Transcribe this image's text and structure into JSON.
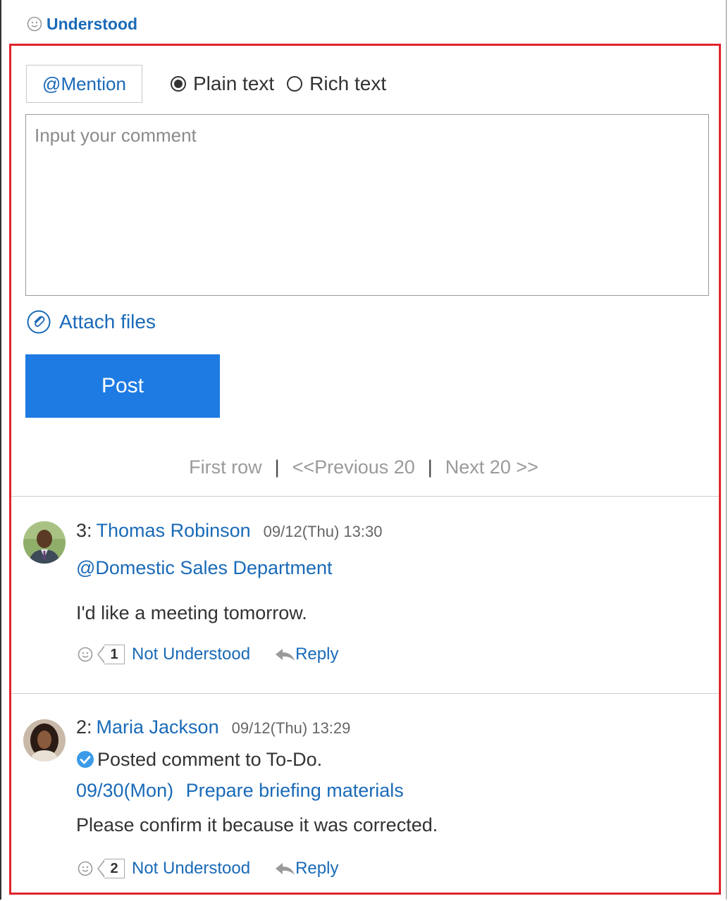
{
  "top": {
    "understood_label": "Understood"
  },
  "form": {
    "mention_label": "@Mention",
    "format_options": [
      {
        "label": "Plain text",
        "selected": true
      },
      {
        "label": "Rich text",
        "selected": false
      }
    ],
    "comment_placeholder": "Input your comment",
    "attach_label": "Attach files",
    "post_label": "Post"
  },
  "pager": {
    "first": "First row",
    "separator": "|",
    "previous": "<<Previous 20",
    "next": "Next 20 >>"
  },
  "comments": [
    {
      "number": "3:",
      "author": "Thomas Robinson",
      "time": "09/12(Thu) 13:30",
      "mention": "@Domestic Sales Department",
      "body": "I'd like a meeting tomorrow.",
      "reaction_count": "1",
      "reaction_label": "Not Understood",
      "reply_label": "Reply"
    },
    {
      "number": "2:",
      "author": "Maria Jackson",
      "time": "09/12(Thu) 13:29",
      "todo_note": "Posted comment to To-Do.",
      "todo_date": "09/30(Mon)",
      "todo_title": "Prepare briefing materials",
      "body": "Please confirm it because it was corrected.",
      "reaction_count": "2",
      "reaction_label": "Not Understood",
      "reply_label": "Reply"
    }
  ],
  "colors": {
    "accent": "#1a6ab8",
    "post_button": "#1e7be3",
    "frame": "#e0242c"
  }
}
